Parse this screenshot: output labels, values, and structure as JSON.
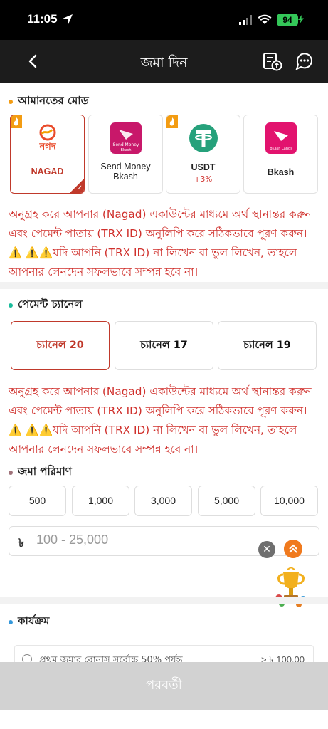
{
  "status_bar": {
    "time": "11:05",
    "battery": "94"
  },
  "header": {
    "title": "জমা দিন",
    "back_icon": "chevron-left-icon",
    "history_icon": "deposit-history-icon",
    "chat_icon": "support-chat-icon"
  },
  "payment_mode": {
    "title": "আমানতের মোড",
    "items": [
      {
        "label": "NAGAD",
        "sub": "",
        "logo_text": "নগদ",
        "selected": true,
        "hot": true
      },
      {
        "label": "Send Money\nBkash",
        "sub": "",
        "logo_text": "Send Money\nBkash",
        "selected": false,
        "hot": false
      },
      {
        "label": "USDT",
        "sub": "+3%",
        "logo_text": "",
        "selected": false,
        "hot": true
      },
      {
        "label": "Bkash",
        "sub": "",
        "logo_text": "bKash Lands",
        "selected": false,
        "hot": false
      }
    ]
  },
  "notice_1": "অনুগ্রহ করে আপনার (Nagad) একাউন্টের মাধ্যমে অর্থ স্থানান্তর করুন এবং পেমেন্ট পাতায় (TRX ID) অনুলিপি করে সঠিকভাবে পূরণ করুন। ⚠️ ⚠️⚠️যদি আপনি (TRX ID) না লিখেন বা ভুল লিখেন, তাহলে আপনার লেনদেন সফলভাবে সম্পন্ন হবে না।",
  "payment_channel": {
    "title": "পেমেন্ট চ্যানেল",
    "items": [
      {
        "label": "চ্যানেল 20",
        "selected": true
      },
      {
        "label": "চ্যানেল 17",
        "selected": false
      },
      {
        "label": "চ্যানেল 19",
        "selected": false
      }
    ]
  },
  "notice_2": "অনুগ্রহ করে আপনার (Nagad) একাউন্টের মাধ্যমে অর্থ স্থানান্তর করুন এবং পেমেন্ট পাতায় (TRX ID) অনুলিপি করে সঠিকভাবে পূরণ করুন। ⚠️ ⚠️⚠️যদি আপনি (TRX ID) না লিখেন বা ভুল লিখেন, তাহলে আপনার লেনদেন সফলভাবে সম্পন্ন হবে না।",
  "deposit_amount": {
    "title": "জমা পরিমাণ",
    "presets": [
      "500",
      "1,000",
      "3,000",
      "5,000",
      "10,000"
    ],
    "currency": "৳",
    "placeholder": "100 - 25,000",
    "value": ""
  },
  "activity": {
    "title": "কার্যক্রম",
    "promo_text": "প্রথম জমার বোনাস সর্বোচ্চ 50% পর্যন্ত",
    "promo_amount": "> ৳ 100.00"
  },
  "next_button": "পরবর্তী",
  "colors": {
    "accent": "#c0392b",
    "notice": "#d0312d",
    "header_bg": "#1c1c1c",
    "disabled": "#d2d2d2",
    "usdt": "#26a17b",
    "bkash": "#e2136e",
    "orange": "#f07a1e"
  }
}
